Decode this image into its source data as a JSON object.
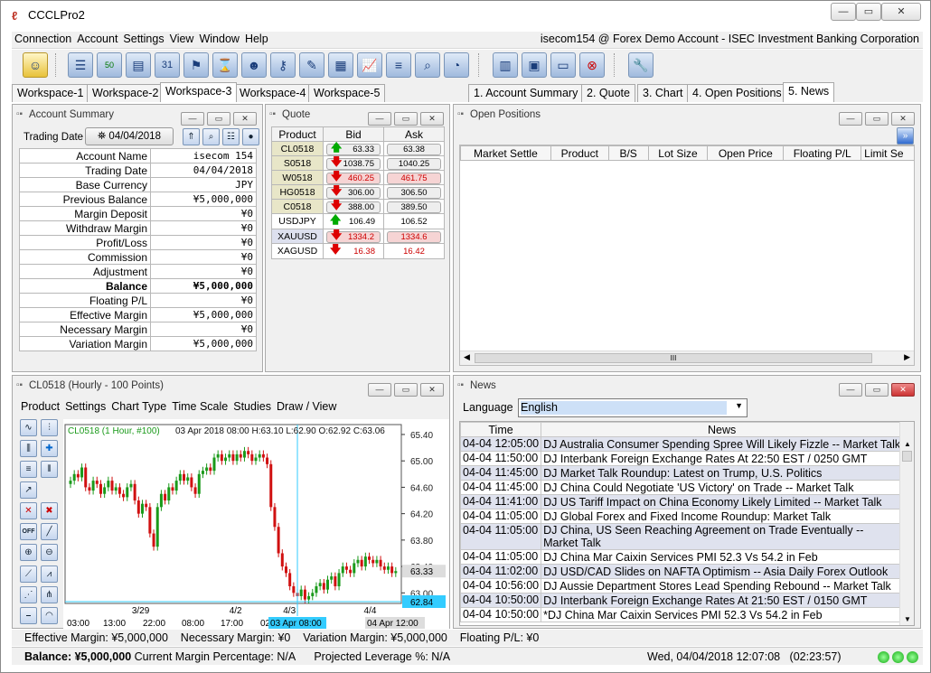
{
  "window": {
    "title": "CCCLPro2"
  },
  "menu": {
    "items": [
      "Connection",
      "Account",
      "Settings",
      "View",
      "Window",
      "Help"
    ],
    "account_label": "isecom154 @ Forex Demo Account - ISEC Investment Banking Corporation"
  },
  "workspaces": [
    "Workspace-1",
    "Workspace-2",
    "Workspace-3",
    "Workspace-4",
    "Workspace-5"
  ],
  "view_tabs": [
    "1. Account Summary",
    "2. Quote",
    "3. Chart",
    "4. Open Positions",
    "5. News"
  ],
  "account_summary": {
    "title": "Account Summary",
    "trading_date_label": "Trading Date",
    "trading_date_value": "04/04/2018",
    "rows": [
      {
        "k": "Account Name",
        "v": "isecom 154"
      },
      {
        "k": "Trading Date",
        "v": "04/04/2018"
      },
      {
        "k": "Base Currency",
        "v": "JPY"
      },
      {
        "k": "Previous Balance",
        "v": "¥5,000,000"
      },
      {
        "k": "Margin Deposit",
        "v": "¥0"
      },
      {
        "k": "Withdraw Margin",
        "v": "¥0"
      },
      {
        "k": "Profit/Loss",
        "v": "¥0"
      },
      {
        "k": "Commission",
        "v": "¥0"
      },
      {
        "k": "Adjustment",
        "v": "¥0"
      },
      {
        "k": "Balance",
        "v": "¥5,000,000"
      },
      {
        "k": "Floating P/L",
        "v": "¥0"
      },
      {
        "k": "Effective Margin",
        "v": "¥5,000,000"
      },
      {
        "k": "Necessary Margin",
        "v": "¥0"
      },
      {
        "k": "Variation Margin",
        "v": "¥5,000,000"
      }
    ]
  },
  "quote": {
    "title": "Quote",
    "headers": [
      "Product",
      "Bid",
      "Ask"
    ],
    "rows": [
      {
        "p": "CL0518",
        "bid": "63.33",
        "ask": "63.38",
        "dir": "up",
        "red": false,
        "bg": "#e8e6c8"
      },
      {
        "p": "S0518",
        "bid": "1038.75",
        "ask": "1040.25",
        "dir": "down",
        "red": false,
        "bg": "#e8e6c8"
      },
      {
        "p": "W0518",
        "bid": "460.25",
        "ask": "461.75",
        "dir": "down",
        "red": true,
        "bg": "#e8e6c8"
      },
      {
        "p": "HG0518",
        "bid": "306.00",
        "ask": "306.50",
        "dir": "down",
        "red": false,
        "bg": "#e8e6c8"
      },
      {
        "p": "C0518",
        "bid": "388.00",
        "ask": "389.50",
        "dir": "down",
        "red": false,
        "bg": "#e8e6c8"
      },
      {
        "p": "USDJPY",
        "bid": "106.49",
        "ask": "106.52",
        "dir": "up",
        "red": false,
        "bg": "#ffffff"
      },
      {
        "p": "XAUUSD",
        "bid": "1334.2",
        "ask": "1334.6",
        "dir": "down",
        "red": true,
        "bg": "#dde0ee"
      },
      {
        "p": "XAGUSD",
        "bid": "16.38",
        "ask": "16.42",
        "dir": "down",
        "red": true,
        "bg": "#ffffff"
      }
    ]
  },
  "open_positions": {
    "title": "Open Positions",
    "headers": [
      "Market Settle",
      "Product",
      "B/S",
      "Lot Size",
      "Open Price",
      "Floating P/L",
      "Limit Se"
    ]
  },
  "chart": {
    "title": "CL0518 (Hourly - 100 Points)",
    "menu": [
      "Product",
      "Settings",
      "Chart Type",
      "Time Scale",
      "Studies",
      "Draw / View"
    ],
    "legend": "CL0518 (1 Hour, #100)",
    "ohlc": "03 Apr 2018 08:00 H:63.10 L:62.90 O:62.92 C:63.06",
    "cursor_time": "03 Apr 08:00",
    "end_time": "04 Apr 12:00",
    "last_price": "63.33",
    "cursor_price": "62.84",
    "accent": "#3cf"
  },
  "chart_data": {
    "type": "candlestick",
    "title": "CL0518 (1 Hour, #100)",
    "y_ticks": [
      "65.40",
      "65.00",
      "64.60",
      "64.20",
      "63.80",
      "63.40",
      "63.00"
    ],
    "ylim": [
      62.84,
      65.55
    ],
    "x_ticks_bottom": [
      "03:00",
      "13:00",
      "22:00",
      "08:00",
      "17:00",
      "02:00",
      "13:00",
      "03 Apr 08:00",
      "04 Apr 12:00"
    ],
    "date_ticks": [
      "3/29",
      "4/2",
      "4/3",
      "4/4"
    ],
    "closes": [
      64.7,
      64.8,
      64.75,
      64.9,
      64.6,
      64.55,
      64.7,
      64.65,
      64.5,
      64.6,
      64.7,
      64.55,
      64.6,
      64.5,
      64.45,
      64.6,
      64.65,
      64.4,
      64.2,
      64.35,
      64.3,
      63.9,
      63.7,
      64.3,
      64.5,
      64.4,
      64.6,
      64.55,
      64.7,
      64.8,
      64.7,
      64.75,
      64.6,
      64.5,
      64.8,
      64.85,
      64.9,
      64.85,
      65.05,
      65.1,
      65.0,
      65.05,
      65.1,
      65.0,
      65.1,
      65.05,
      65.15,
      65.1,
      65.0,
      65.05,
      65.1,
      65.05,
      64.95,
      64.3,
      64.0,
      63.6,
      63.4,
      63.3,
      63.1,
      63.0,
      62.95,
      63.05,
      62.9,
      62.95,
      63.0,
      63.1,
      63.15,
      63.05,
      63.2,
      63.25,
      63.1,
      63.3,
      63.4,
      63.35,
      63.3,
      63.45,
      63.5,
      63.4,
      63.55,
      63.5,
      63.45,
      63.5,
      63.4,
      63.35,
      63.4,
      63.3,
      63.33
    ]
  },
  "news": {
    "title": "News",
    "language_label": "Language",
    "language_value": "English",
    "headers": [
      "Time",
      "News"
    ],
    "rows": [
      {
        "t": "04-04 12:05:00",
        "n": "DJ Australia Consumer Spending Spree Will Likely Fizzle -- Market Talk",
        "alt": true
      },
      {
        "t": "04-04 11:50:00",
        "n": "DJ Interbank Foreign Exchange Rates At 22:50 EST / 0250 GMT",
        "alt": false
      },
      {
        "t": "04-04 11:45:00",
        "n": "DJ Market Talk Roundup: Latest on Trump, U.S. Politics",
        "alt": true
      },
      {
        "t": "04-04 11:45:00",
        "n": "DJ China Could Negotiate 'US Victory' on Trade -- Market Talk",
        "alt": false
      },
      {
        "t": "04-04 11:41:00",
        "n": "DJ US Tariff Impact on China Economy Likely Limited -- Market Talk",
        "alt": true
      },
      {
        "t": "04-04 11:05:00",
        "n": "DJ Global Forex and Fixed Income Roundup: Market Talk",
        "alt": false
      },
      {
        "t": "04-04 11:05:00",
        "n": "DJ China, US Seen Reaching Agreement on Trade Eventually --",
        "n2": "Market Talk",
        "alt": true
      },
      {
        "t": "04-04 11:05:00",
        "n": "DJ China Mar Caixin Services PMI 52.3 Vs 54.2 in Feb",
        "alt": false
      },
      {
        "t": "04-04 11:02:00",
        "n": "DJ USD/CAD Slides on NAFTA Optimism -- Asia Daily Forex Outlook",
        "alt": true
      },
      {
        "t": "04-04 10:56:00",
        "n": "DJ Aussie Department Stores Lead Spending Rebound -- Market Talk",
        "alt": false
      },
      {
        "t": "04-04 10:50:00",
        "n": "DJ Interbank Foreign Exchange Rates At 21:50 EST / 0150 GMT",
        "alt": true
      },
      {
        "t": "04-04 10:50:00",
        "n": "*DJ China Mar Caixin Services PMI 52.3 Vs 54.2 in Feb",
        "alt": false
      }
    ]
  },
  "status": {
    "line1": "Effective Margin: ¥5,000,000    Necessary Margin: ¥0    Variation Margin: ¥5,000,000    Floating P/L: ¥0",
    "balance": "Balance: ¥5,000,000",
    "line2_rest": "Current Margin Percentage: N/A      Projected Leverage %: N/A",
    "datetime": "Wed, 04/04/2018 12:07:08   (02:23:57)"
  }
}
